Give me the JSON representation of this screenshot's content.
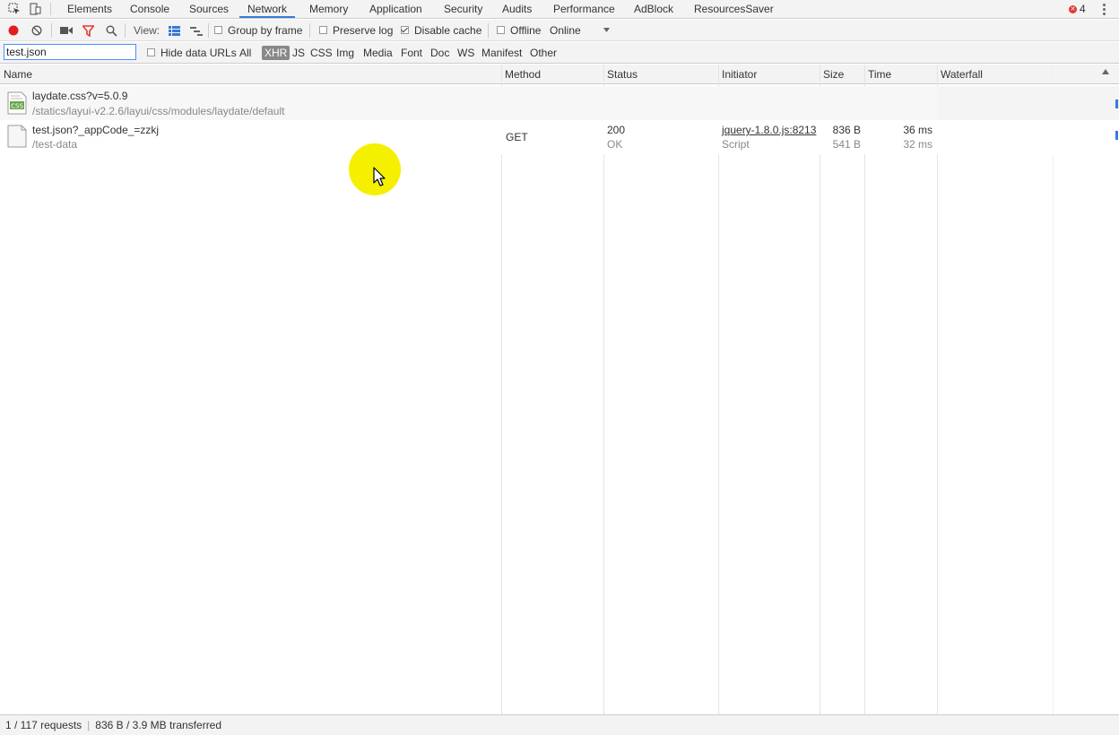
{
  "tabs": [
    "Elements",
    "Console",
    "Sources",
    "Network",
    "Memory",
    "Application",
    "Security",
    "Audits",
    "Performance",
    "AdBlock",
    "ResourcesSaver"
  ],
  "active_tab": "Network",
  "error_count": "4",
  "toolbar": {
    "view_label": "View:",
    "group_by_frame": "Group by frame",
    "preserve_log": "Preserve log",
    "disable_cache": "Disable cache",
    "offline": "Offline",
    "throttling": "Online"
  },
  "filter": {
    "value": "test.json",
    "hide_data_urls": "Hide data URLs",
    "types": [
      "All",
      "XHR",
      "JS",
      "CSS",
      "Img",
      "Media",
      "Font",
      "Doc",
      "WS",
      "Manifest",
      "Other"
    ],
    "selected_type": "XHR"
  },
  "columns": [
    "Name",
    "Method",
    "Status",
    "Initiator",
    "Size",
    "Time",
    "Waterfall"
  ],
  "requests": [
    {
      "name": "laydate.css?v=5.0.9",
      "path": "/statics/layui-v2.2.6/layui/css/modules/laydate/default",
      "icon": "css-file-icon",
      "method": "",
      "status": "",
      "status_text": "",
      "initiator": "",
      "initiator_type": "",
      "size": "",
      "size_content": "",
      "time": "",
      "latency": ""
    },
    {
      "name": "test.json?_appCode_=zzkj",
      "path": "/test-data",
      "icon": "document-file-icon",
      "method": "GET",
      "status": "200",
      "status_text": "OK",
      "initiator": "jquery-1.8.0.js:8213",
      "initiator_type": "Script",
      "size": "836 B",
      "size_content": "541 B",
      "time": "36 ms",
      "latency": "32 ms"
    }
  ],
  "status_bar": {
    "requests": "1 / 117 requests",
    "transferred": "836 B / 3.9 MB transferred"
  },
  "colors": {
    "accent": "#3879d9",
    "record": "#e0201e",
    "filter_icon": "#e53935",
    "cursor_highlight": "#f5f000"
  }
}
